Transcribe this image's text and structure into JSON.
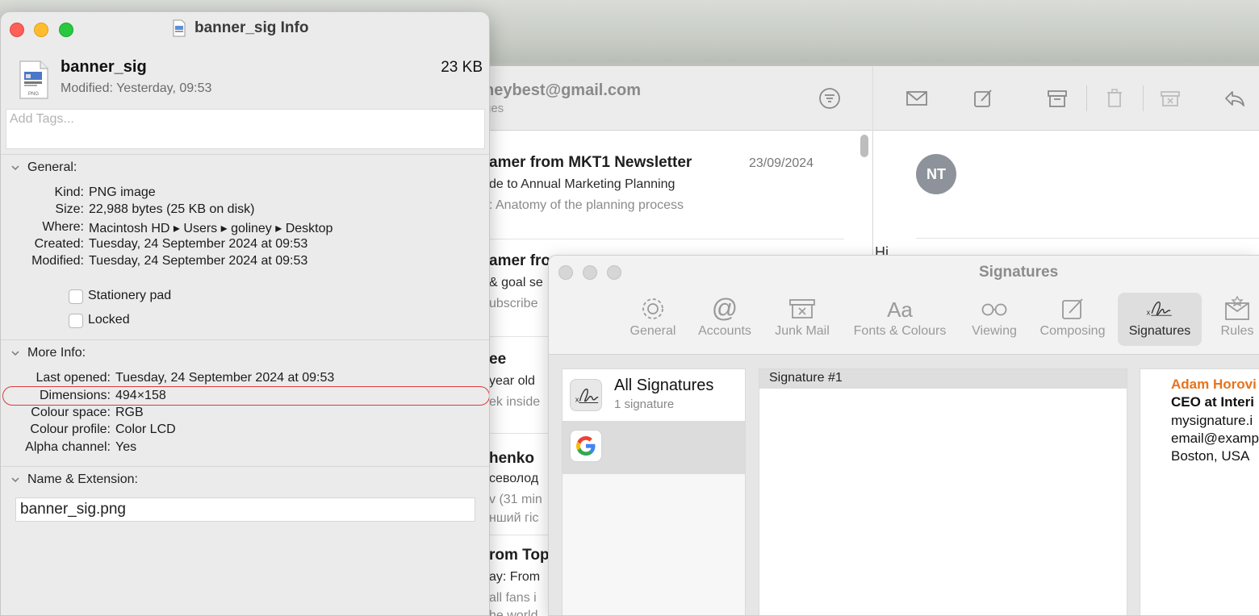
{
  "mail": {
    "account_email": "neybest@gmail.com",
    "account_sub": "ges",
    "messages": [
      {
        "sender": "amer from MKT1 Newsletter",
        "date": "23/09/2024",
        "subject": "de to Annual Marketing Planning",
        "preview": ": Anatomy of the planning process"
      },
      {
        "sender": "amer fro",
        "date": "",
        "subject": "& goal se",
        "preview": "ubscribe"
      },
      {
        "sender": "ee",
        "date": "",
        "subject": "year old",
        "preview": "ek inside"
      },
      {
        "sender": "henko",
        "date": "",
        "subject": "севолод",
        "preview": "v (31 min",
        "preview2": "нший гіс"
      },
      {
        "sender": "rom Top",
        "date": "",
        "subject": "ay: From",
        "preview": "all fans i",
        "preview2": "he world"
      }
    ],
    "reader": {
      "avatar_initials": "NT",
      "greeting": "Hi"
    }
  },
  "info_window": {
    "title": "banner_sig Info",
    "file_name": "banner_sig",
    "file_size": "23 KB",
    "modified_line": "Modified: Yesterday, 09:53",
    "tags_placeholder": "Add Tags...",
    "general": {
      "heading": "General:",
      "rows": [
        {
          "label": "Kind:",
          "value": "PNG image"
        },
        {
          "label": "Size:",
          "value": "22,988 bytes (25 KB on disk)"
        },
        {
          "label": "Where:",
          "value": "Macintosh HD ▸ Users ▸ goliney ▸ Desktop"
        },
        {
          "label": "Created:",
          "value": "Tuesday, 24 September 2024 at 09:53"
        },
        {
          "label": "Modified:",
          "value": "Tuesday, 24 September 2024 at 09:53"
        }
      ],
      "stationery_label": "Stationery pad",
      "locked_label": "Locked",
      "stationery_checked": false,
      "locked_checked": false
    },
    "more_info": {
      "heading": "More Info:",
      "rows": [
        {
          "label": "Last opened:",
          "value": "Tuesday, 24 September 2024 at 09:53"
        },
        {
          "label": "Dimensions:",
          "value": "494×158"
        },
        {
          "label": "Colour space:",
          "value": "RGB"
        },
        {
          "label": "Colour profile:",
          "value": "Color LCD"
        },
        {
          "label": "Alpha channel:",
          "value": "Yes"
        }
      ]
    },
    "name_ext": {
      "heading": "Name & Extension:",
      "value": "banner_sig.png"
    },
    "highlight_color": "#d93c3c"
  },
  "signatures_window": {
    "title": "Signatures",
    "tabs": [
      {
        "label": "General",
        "icon": "gear-icon"
      },
      {
        "label": "Accounts",
        "icon": "at-icon"
      },
      {
        "label": "Junk Mail",
        "icon": "junk-mail-icon"
      },
      {
        "label": "Fonts & Colours",
        "icon": "fonts-icon"
      },
      {
        "label": "Viewing",
        "icon": "glasses-icon"
      },
      {
        "label": "Composing",
        "icon": "compose-icon"
      },
      {
        "label": "Signatures",
        "icon": "signature-icon",
        "active": true
      },
      {
        "label": "Rules",
        "icon": "rules-icon"
      }
    ],
    "accounts": [
      {
        "name": "All Signatures",
        "sub": "1 signature"
      },
      {
        "name": "",
        "icon": "google-icon"
      }
    ],
    "signatures": [
      "Signature #1"
    ],
    "preview": {
      "name": "Adam Horovi",
      "role": "CEO at Interi",
      "line1": "mysignature.i",
      "line2": "email@examp",
      "line3": "Boston, USA",
      "name_color": "#e8731a"
    }
  }
}
